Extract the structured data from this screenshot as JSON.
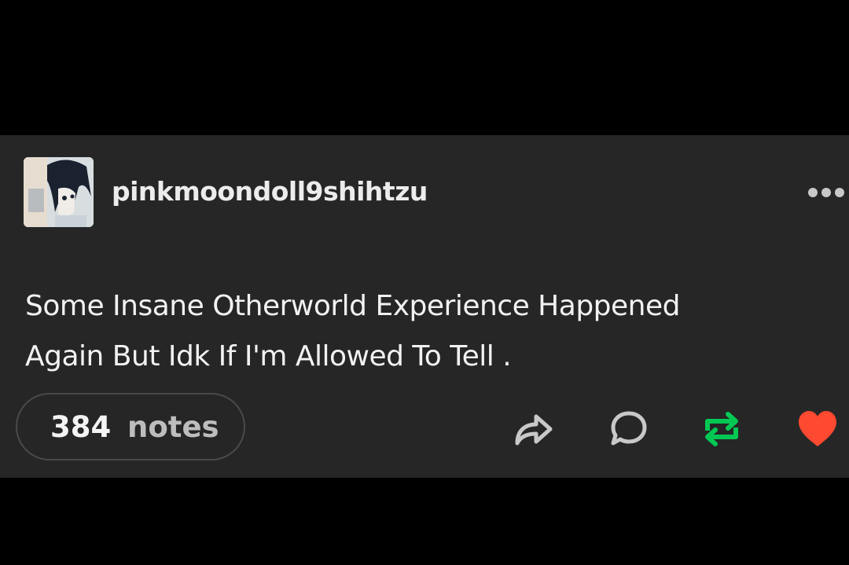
{
  "post": {
    "username": "pinkmoondoll9shihtzu",
    "body_text": "Some Insane Otherworld Experience Happened\nAgain   But Idk If I'm Allowed To Tell  .",
    "notes_count": "384",
    "notes_label": "notes"
  },
  "icons": {
    "more": "more-dots-icon",
    "share": "share-arrow-icon",
    "reply": "reply-bubble-icon",
    "reblog": "reblog-icon",
    "like": "heart-icon"
  },
  "colors": {
    "card_background": "#262626",
    "page_background": "#000000",
    "text_primary": "#f2f2f2",
    "text_secondary": "#bdbdbd",
    "reblog_green": "#00c853",
    "like_red": "#ff4930",
    "icon_gray": "#c8c8c8"
  }
}
